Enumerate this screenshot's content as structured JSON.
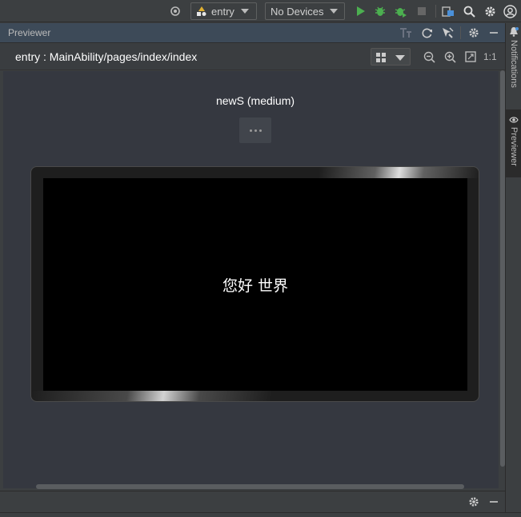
{
  "toolbar": {
    "module_combo": "entry",
    "device_combo": "No Devices"
  },
  "panel": {
    "title": "Previewer"
  },
  "path_bar": {
    "path": "entry : MainAbility/pages/index/index",
    "zoom_label": "1:1"
  },
  "preview": {
    "device_name": "newS (medium)",
    "screen_text": "您好 世界"
  },
  "right_strip": {
    "tabs": [
      {
        "label": "Notifications"
      },
      {
        "label": "Previewer"
      }
    ]
  },
  "colors": {
    "run_green": "#4caf50",
    "accent_yellow": "#e0b030"
  }
}
